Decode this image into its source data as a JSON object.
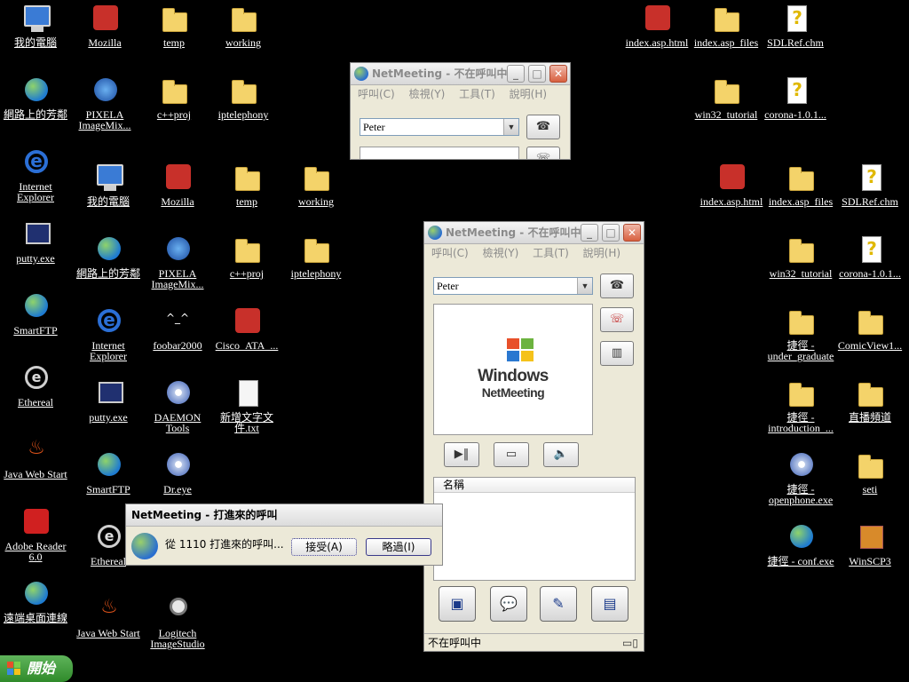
{
  "desktop": {
    "icons_left1": [
      {
        "label": "我的電腦",
        "icon": "my-computer-icon"
      },
      {
        "label": "網路上的芳鄰",
        "icon": "network-places-icon"
      },
      {
        "label": "Internet Explorer",
        "icon": "internet-explorer-icon"
      },
      {
        "label": "putty.exe",
        "icon": "putty-icon"
      },
      {
        "label": "SmartFTP",
        "icon": "smartftp-icon"
      },
      {
        "label": "Ethereal",
        "icon": "ethereal-icon"
      },
      {
        "label": "Java Web Start",
        "icon": "java-icon"
      },
      {
        "label": "Adobe Reader 6.0",
        "icon": "adobe-reader-icon"
      },
      {
        "label": "遠端桌面連線",
        "icon": "remote-desktop-icon"
      }
    ],
    "icons_top": [
      {
        "label": "Mozilla",
        "icon": "mozilla-icon"
      },
      {
        "label": "temp",
        "icon": "folder-icon"
      },
      {
        "label": "working",
        "icon": "folder-icon"
      },
      {
        "label": "PIXELA ImageMix...",
        "icon": "imagemix-icon"
      },
      {
        "label": "c++proj",
        "icon": "folder-icon"
      },
      {
        "label": "iptelephony",
        "icon": "folder-icon"
      }
    ],
    "icons_left2": [
      {
        "label": "我的電腦",
        "icon": "my-computer-icon"
      },
      {
        "label": "網路上的芳鄰",
        "icon": "network-places-icon"
      },
      {
        "label": "Internet Explorer",
        "icon": "internet-explorer-icon"
      },
      {
        "label": "putty.exe",
        "icon": "putty-icon"
      },
      {
        "label": "SmartFTP",
        "icon": "smartftp-icon"
      },
      {
        "label": "Ethereal",
        "icon": "ethereal-icon"
      },
      {
        "label": "Java Web Start",
        "icon": "java-icon"
      }
    ],
    "icons_mid": [
      {
        "label": "Mozilla",
        "icon": "mozilla-icon"
      },
      {
        "label": "temp",
        "icon": "folder-icon"
      },
      {
        "label": "working",
        "icon": "folder-icon"
      },
      {
        "label": "PIXELA ImageMix...",
        "icon": "imagemix-icon"
      },
      {
        "label": "c++proj",
        "icon": "folder-icon"
      },
      {
        "label": "iptelephony",
        "icon": "folder-icon"
      },
      {
        "label": "foobar2000",
        "icon": "foobar-icon"
      },
      {
        "label": "Cisco_ATA_...",
        "icon": "cisco-icon"
      },
      {
        "label": "DAEMON Tools",
        "icon": "daemon-tools-icon"
      },
      {
        "label": "新增文字文件.txt",
        "icon": "text-file-icon"
      },
      {
        "label": "Dr.eye",
        "icon": "dreye-icon"
      },
      {
        "label": "Logitech ImageStudio",
        "icon": "webcam-icon"
      }
    ],
    "icons_right_top": [
      {
        "label": "index.asp.html",
        "icon": "mozilla-icon"
      },
      {
        "label": "index.asp_files",
        "icon": "folder-icon"
      },
      {
        "label": "SDLRef.chm",
        "icon": "help-file-icon"
      },
      {
        "label": "win32_tutorial",
        "icon": "folder-icon"
      },
      {
        "label": "corona-1.0.1...",
        "icon": "help-file-icon"
      }
    ],
    "icons_right": [
      {
        "label": "index.asp.html",
        "icon": "mozilla-icon"
      },
      {
        "label": "index.asp_files",
        "icon": "folder-icon"
      },
      {
        "label": "SDLRef.chm",
        "icon": "help-file-icon"
      },
      {
        "label": "win32_tutorial",
        "icon": "folder-icon"
      },
      {
        "label": "corona-1.0.1...",
        "icon": "help-file-icon"
      },
      {
        "label": "捷徑 - under_graduate",
        "icon": "folder-icon"
      },
      {
        "label": "ComicView1...",
        "icon": "folder-icon"
      },
      {
        "label": "捷徑 - introduction_...",
        "icon": "folder-icon"
      },
      {
        "label": "直播頻道",
        "icon": "folder-icon"
      },
      {
        "label": "捷徑 - openphone.exe",
        "icon": "openphone-icon"
      },
      {
        "label": "seti",
        "icon": "folder-icon"
      },
      {
        "label": "捷徑 - conf.exe",
        "icon": "netmeeting-icon"
      },
      {
        "label": "WinSCP3",
        "icon": "winscp-icon"
      }
    ]
  },
  "netmeeting_back": {
    "title": "NetMeeting - 不在呼叫中",
    "menu": [
      "呼叫(C)",
      "檢視(Y)",
      "工具(T)",
      "說明(H)"
    ],
    "address": "Peter"
  },
  "netmeeting": {
    "title": "NetMeeting - 不在呼叫中",
    "menu": [
      "呼叫(C)",
      "檢視(Y)",
      "工具(T)",
      "說明(H)"
    ],
    "address": "Peter",
    "logo_line1": "Windows",
    "logo_line2": "NetMeeting",
    "list_header": "名稱",
    "status": "不在呼叫中"
  },
  "incoming_call": {
    "title": "NetMeeting - 打進來的呼叫",
    "message": "從 1110 打進來的呼叫...",
    "accept": "接受(A)",
    "ignore": "略過(I)"
  },
  "taskbar": {
    "start_label": "開始"
  },
  "colors": {
    "desktop_bg": "#000000",
    "window_face": "#ece9d8",
    "start_green": "#3c9a37"
  }
}
